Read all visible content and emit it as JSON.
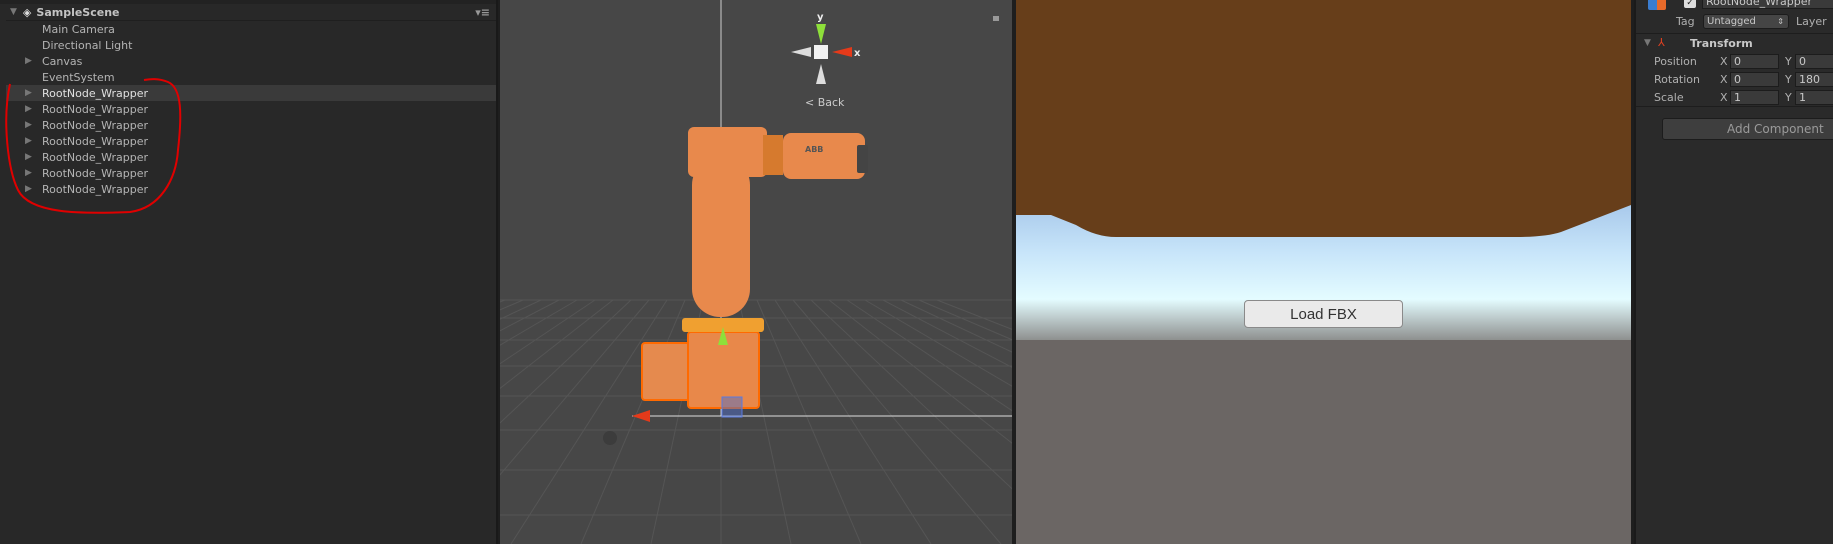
{
  "hierarchy": {
    "scene_name": "SampleScene",
    "items": [
      {
        "label": "Main Camera",
        "expandable": false
      },
      {
        "label": "Directional Light",
        "expandable": false
      },
      {
        "label": "Canvas",
        "expandable": true
      },
      {
        "label": "EventSystem",
        "expandable": false
      },
      {
        "label": "RootNode_Wrapper",
        "expandable": true,
        "selected": true
      },
      {
        "label": "RootNode_Wrapper",
        "expandable": true
      },
      {
        "label": "RootNode_Wrapper",
        "expandable": true
      },
      {
        "label": "RootNode_Wrapper",
        "expandable": true
      },
      {
        "label": "RootNode_Wrapper",
        "expandable": true
      },
      {
        "label": "RootNode_Wrapper",
        "expandable": true
      },
      {
        "label": "RootNode_Wrapper",
        "expandable": true
      }
    ],
    "annotation_color": "#e00000"
  },
  "scene_view": {
    "gizmo": {
      "y": "y",
      "x": "x",
      "back": "Back"
    },
    "model_label": "ABB"
  },
  "game_view": {
    "button": "Load FBX"
  },
  "inspector": {
    "object_name": "RootNode_Wrapper",
    "tag_label": "Tag",
    "tag_value": "Untagged",
    "layer_label": "Layer",
    "component": "Transform",
    "rows": [
      {
        "label": "Position",
        "x_label": "X",
        "x": "0",
        "y_label": "Y",
        "y": "0"
      },
      {
        "label": "Rotation",
        "x_label": "X",
        "x": "0",
        "y_label": "Y",
        "y": "180"
      },
      {
        "label": "Scale",
        "x_label": "X",
        "x": "1",
        "y_label": "Y",
        "y": "1"
      }
    ],
    "add_component": "Add Component"
  }
}
